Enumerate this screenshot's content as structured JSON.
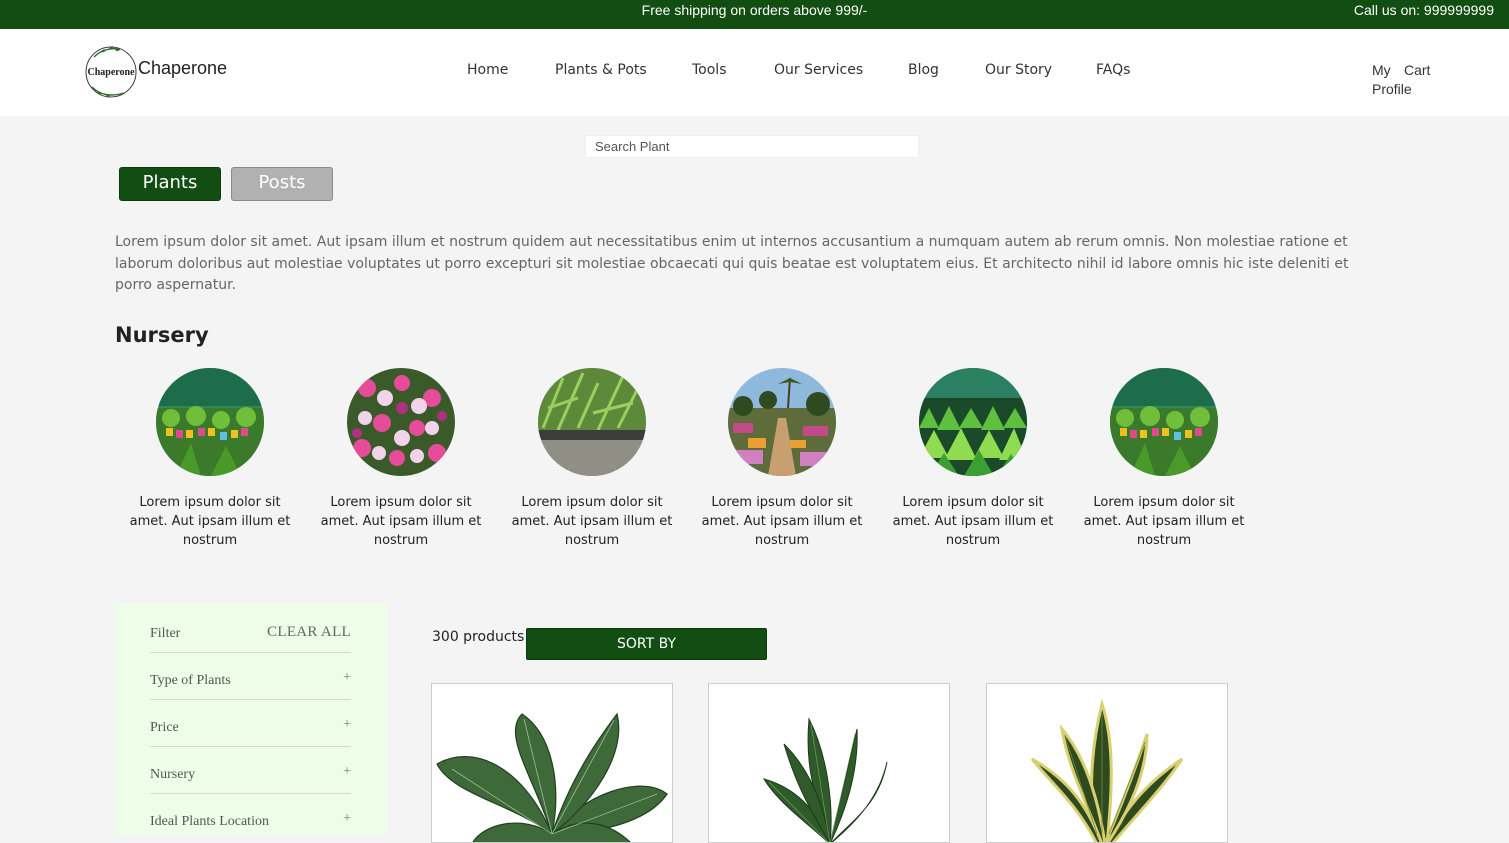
{
  "topbar": {
    "shipping": "Free shipping on orders above 999/-",
    "call": "Call us on: 999999999"
  },
  "header": {
    "logo_text": "Chaperone",
    "brand": "Chaperone",
    "nav": [
      "Home",
      "Plants & Pots",
      "Tools",
      "Our Services",
      "Blog",
      "Our Story",
      "FAQs"
    ],
    "account": {
      "my": "My",
      "profile": "Profile",
      "cart": "Cart"
    }
  },
  "search": {
    "placeholder": "Search Plant"
  },
  "tabs": {
    "plants": "Plants",
    "posts": "Posts"
  },
  "intro": "Lorem ipsum dolor sit amet. Aut ipsam illum et nostrum quidem aut necessitatibus enim ut internos accusantium a numquam autem ab rerum omnis. Non molestiae ratione et laborum doloribus aut molestiae voluptates ut porro excepturi sit molestiae obcaecati qui quis beatae est voluptatem eius. Et architecto nihil id labore omnis hic iste deleniti et porro aspernatur.",
  "nursery": {
    "title": "Nursery",
    "items": [
      "Lorem ipsum dolor sit amet. Aut ipsam illum et nostrum",
      "Lorem ipsum dolor sit amet. Aut ipsam illum et nostrum",
      "Lorem ipsum dolor sit amet. Aut ipsam illum et nostrum",
      "Lorem ipsum dolor sit amet. Aut ipsam illum et nostrum",
      "Lorem ipsum dolor sit amet. Aut ipsam illum et nostrum",
      "Lorem ipsum dolor sit amet. Aut ipsam illum et nostrum"
    ]
  },
  "filter": {
    "title": "Filter",
    "clear": "CLEAR ALL",
    "groups": [
      "Type of Plants",
      "Price",
      "Nursery",
      "Ideal Plants Location"
    ],
    "expand_symbol": "+"
  },
  "products": {
    "count": "300 products",
    "sort": "SORT BY"
  },
  "colors": {
    "brand_green": "#124d12",
    "filter_bg": "#eefde8",
    "tab_inactive": "#b1b1b1"
  }
}
